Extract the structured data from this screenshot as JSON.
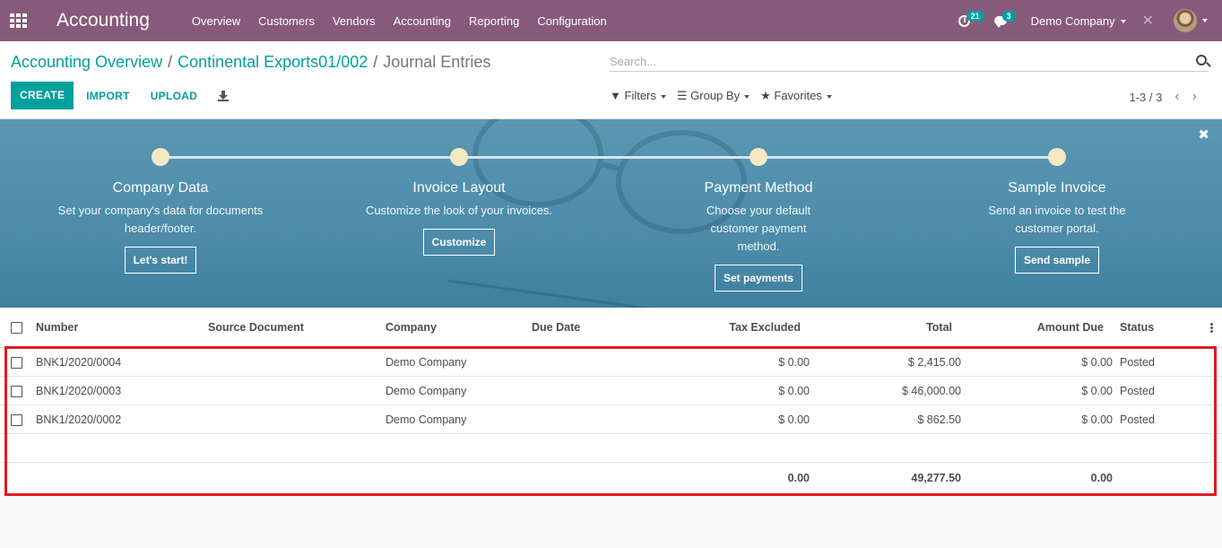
{
  "topbar": {
    "brand": "Accounting",
    "menu": [
      "Overview",
      "Customers",
      "Vendors",
      "Accounting",
      "Reporting",
      "Configuration"
    ],
    "activity_count": "21",
    "message_count": "3",
    "company": "Demo Company"
  },
  "breadcrumb": {
    "items": [
      "Accounting Overview",
      "Continental Exports01/002"
    ],
    "current": "Journal Entries"
  },
  "search": {
    "placeholder": "Search..."
  },
  "buttons": {
    "create": "CREATE",
    "import": "IMPORT",
    "upload": "UPLOAD"
  },
  "filters": {
    "filters": "Filters",
    "group_by": "Group By",
    "favorites": "Favorites"
  },
  "pager": "1-3 / 3",
  "banner": {
    "steps": [
      {
        "title": "Company Data",
        "desc": "Set your company's data for documents header/footer.",
        "button": "Let's start!"
      },
      {
        "title": "Invoice Layout",
        "desc": "Customize the look of your invoices.",
        "button": "Customize"
      },
      {
        "title": "Payment Method",
        "desc": "Choose your default customer payment method.",
        "button": "Set payments"
      },
      {
        "title": "Sample Invoice",
        "desc": "Send an invoice to test the customer portal.",
        "button": "Send sample"
      }
    ]
  },
  "table": {
    "headers": {
      "number": "Number",
      "source": "Source Document",
      "company": "Company",
      "due_date": "Due Date",
      "tax_excluded": "Tax Excluded",
      "total": "Total",
      "amount_due": "Amount Due",
      "status": "Status"
    },
    "rows": [
      {
        "number": "BNK1/2020/0004",
        "company": "Demo Company",
        "tax_excluded": "$ 0.00",
        "total": "$ 2,415.00",
        "amount_due": "$ 0.00",
        "status": "Posted"
      },
      {
        "number": "BNK1/2020/0003",
        "company": "Demo Company",
        "tax_excluded": "$ 0.00",
        "total": "$ 46,000.00",
        "amount_due": "$ 0.00",
        "status": "Posted"
      },
      {
        "number": "BNK1/2020/0002",
        "company": "Demo Company",
        "tax_excluded": "$ 0.00",
        "total": "$ 862.50",
        "amount_due": "$ 0.00",
        "status": "Posted"
      }
    ],
    "totals": {
      "tax_excluded": "0.00",
      "total": "49,277.50",
      "amount_due": "0.00"
    }
  },
  "colors": {
    "brand": "#875a7b",
    "accent": "#00a09d",
    "highlight": "#e01b24"
  }
}
